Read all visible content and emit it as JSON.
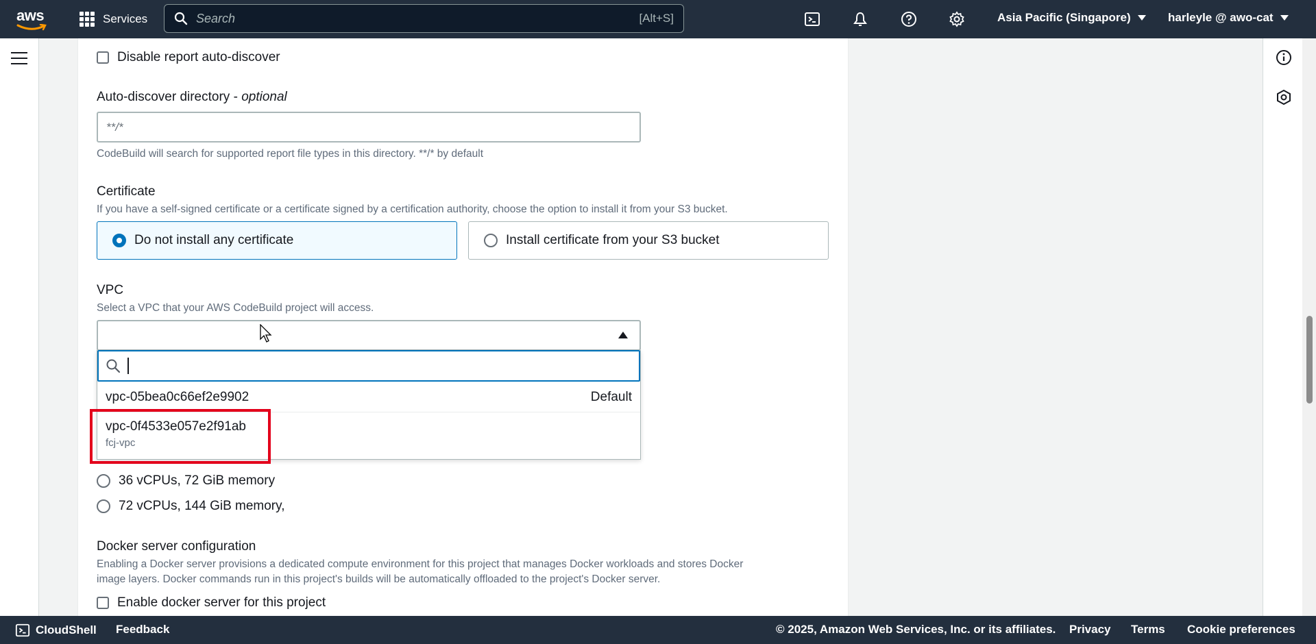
{
  "topnav": {
    "logo_text": "aws",
    "services_label": "Services",
    "search_placeholder": "Search",
    "search_shortcut": "[Alt+S]",
    "region_label": "Asia Pacific (Singapore)",
    "account_label": "harleyle @ awo-cat"
  },
  "form": {
    "disable_autodiscover_label": "Disable report auto-discover",
    "autodiscover_dir_label": "Auto-discover directory - ",
    "autodiscover_dir_optional": "optional",
    "autodiscover_dir_placeholder": "**/*",
    "autodiscover_dir_help": "CodeBuild will search for supported report file types in this directory. **/* by default",
    "certificate_label": "Certificate",
    "certificate_desc": "If you have a self-signed certificate or a certificate signed by a certification authority, choose the option to install it from your S3 bucket.",
    "certificate_options": [
      {
        "label": "Do not install any certificate",
        "selected": true
      },
      {
        "label": "Install certificate from your S3 bucket",
        "selected": false
      }
    ],
    "vpc_label": "VPC",
    "vpc_desc": "Select a VPC that your AWS CodeBuild project will access.",
    "vpc_options": [
      {
        "id": "vpc-05bea0c66ef2e9902",
        "tag": "Default",
        "sub": ""
      },
      {
        "id": "vpc-0f4533e057e2f91ab",
        "tag": "",
        "sub": "fcj-vpc"
      }
    ],
    "compute_options": [
      {
        "label": "36 vCPUs, 72 GiB memory"
      },
      {
        "label": "72 vCPUs, 144 GiB memory,"
      }
    ],
    "docker_label": "Docker server configuration",
    "docker_desc_line1": "Enabling a Docker server provisions a dedicated compute environment for this project that manages Docker workloads and stores Docker",
    "docker_desc_line2": "image layers. Docker commands run in this project's builds will be automatically offloaded to the project's Docker server.",
    "docker_enable_label": "Enable docker server for this project"
  },
  "bottombar": {
    "cloudshell_label": "CloudShell",
    "feedback_label": "Feedback",
    "copyright": "© 2025, Amazon Web Services, Inc. or its affiliates.",
    "privacy_label": "Privacy",
    "terms_label": "Terms",
    "cookie_label": "Cookie preferences"
  },
  "colors": {
    "nav_bg": "#232f3e",
    "accent": "#0073bb",
    "highlight": "#e3001b"
  }
}
